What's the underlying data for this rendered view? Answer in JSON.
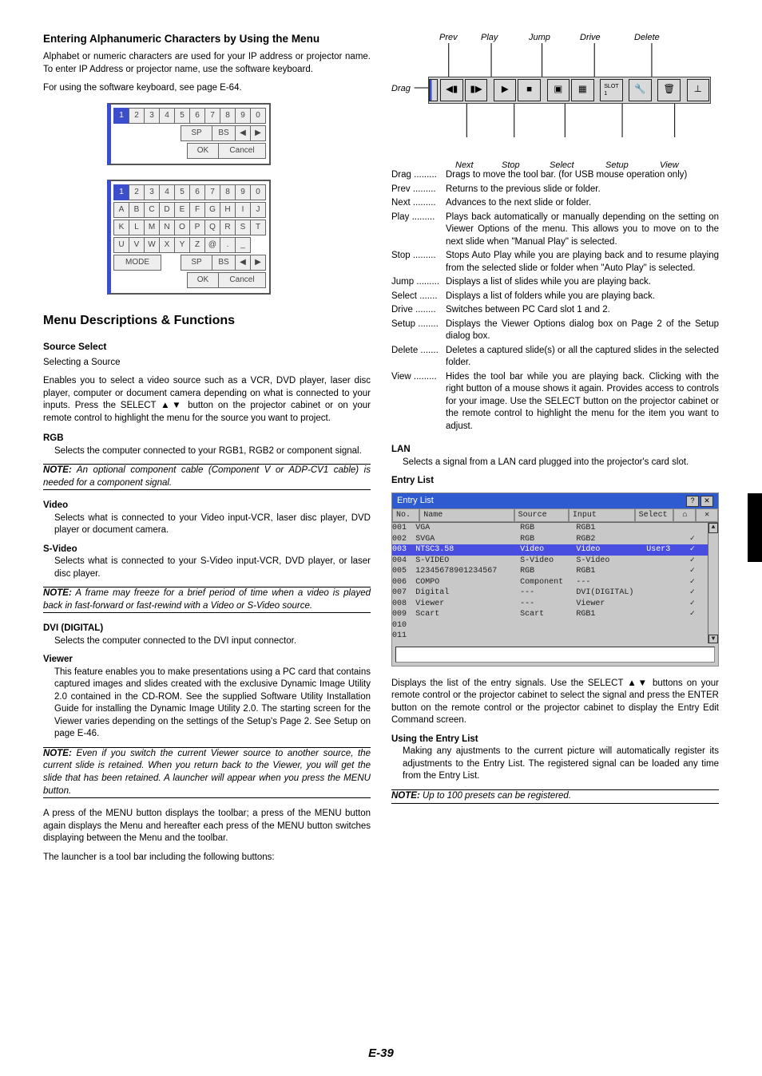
{
  "page_number": "E-39",
  "left": {
    "h_enter": "Entering Alphanumeric Characters by Using the Menu",
    "p_enter1": "Alphabet or numeric characters are used for your IP address or projector name. To enter IP Address or projector name, use the software keyboard.",
    "p_enter2": "For using the software keyboard, see page E-64.",
    "kb_digits": [
      "1",
      "2",
      "3",
      "4",
      "5",
      "6",
      "7",
      "8",
      "9",
      "0"
    ],
    "kb_sp": "SP",
    "kb_bs": "BS",
    "kb_ok": "OK",
    "kb_cancel": "Cancel",
    "kb_alpha": [
      [
        "A",
        "B",
        "C",
        "D",
        "E",
        "F",
        "G",
        "H",
        "I",
        "J"
      ],
      [
        "K",
        "L",
        "M",
        "N",
        "O",
        "P",
        "Q",
        "R",
        "S",
        "T"
      ],
      [
        "U",
        "V",
        "W",
        "X",
        "Y",
        "Z",
        "@",
        ".",
        "_"
      ]
    ],
    "kb_mode": "MODE",
    "h_menu": "Menu Descriptions & Functions",
    "h_source": "Source Select",
    "p_source1": "Selecting a Source",
    "p_source2": "Enables you to select a video source such as a VCR, DVD player, laser disc player, computer or document camera depending on what is connected to your inputs. Press the SELECT ▲▼ button on the projector cabinet or on your remote control to highlight the menu for the source you want to project.",
    "h_rgb": "RGB",
    "p_rgb": "Selects the computer connected to your RGB1, RGB2 or component signal.",
    "note_rgb": "An optional component cable (Component V or ADP-CV1 cable) is needed for a component signal.",
    "h_video": "Video",
    "p_video": "Selects what is connected to your Video input-VCR, laser disc player, DVD player or document camera.",
    "h_svideo": "S-Video",
    "p_svideo": "Selects what is connected to your S-Video input-VCR, DVD player, or laser disc player.",
    "note_svideo": "A frame may freeze for a brief period of time when a video is played back in fast-forward or fast-rewind with a Video or S-Video source.",
    "h_dvi": "DVI (DIGITAL)",
    "p_dvi": "Selects the computer connected to the DVI input connector.",
    "h_viewer": "Viewer",
    "p_viewer": "This feature enables you to make presentations using a PC card that contains captured images and slides created with the exclusive Dynamic Image Utility 2.0 contained in the CD-ROM. See the supplied Software Utility Installation Guide for installing the Dynamic Image Utility 2.0. The starting screen for the Viewer varies depending on the settings of the Setup's Page 2. See Setup on page E-46.",
    "note_viewer": "Even if you switch the current Viewer source to another source, the current slide is retained. When you return back to the Viewer, you will get the slide that has been retained. A launcher will appear when you press the MENU button.",
    "p_launcher": "A press of the MENU button displays the toolbar; a press of the MENU button again displays the Menu and hereafter each press of the MENU button switches displaying between the Menu and the toolbar.",
    "p_launcher2": "The launcher is a tool bar including the following buttons:"
  },
  "toolbar": {
    "labels_top": {
      "prev": "Prev",
      "play": "Play",
      "jump": "Jump",
      "drive": "Drive",
      "delete": "Delete"
    },
    "labels_bot": {
      "next": "Next",
      "stop": "Stop",
      "select": "Select",
      "setup": "Setup",
      "view": "View"
    },
    "drag": "Drag"
  },
  "defs": [
    {
      "t": "Drag",
      "d": "Drags to move the tool bar. (for USB mouse operation only)"
    },
    {
      "t": "Prev",
      "d": "Returns to the previous slide or folder."
    },
    {
      "t": "Next",
      "d": "Advances to the next slide or folder."
    },
    {
      "t": "Play",
      "d": "Plays back automatically or manually depending on the setting on Viewer Options of the menu. This allows you to move on to the next slide when \"Manual Play\" is selected."
    },
    {
      "t": "Stop",
      "d": "Stops Auto Play while you are playing back and to resume playing from the selected slide or folder when \"Auto Play\" is selected."
    },
    {
      "t": "Jump",
      "d": "Displays a list of slides while you are playing back."
    },
    {
      "t": "Select",
      "d": "Displays a list of folders while you are playing back."
    },
    {
      "t": "Drive",
      "d": "Switches between PC Card slot 1 and 2."
    },
    {
      "t": "Setup",
      "d": "Displays the Viewer Options dialog box on Page 2 of the Setup dialog box."
    },
    {
      "t": "Delete",
      "d": "Deletes a captured slide(s) or all the captured slides in the selected folder."
    },
    {
      "t": "View",
      "d": "Hides the tool bar while you are playing back. Clicking with the right button of a mouse shows it again. Provides access to controls for your image. Use the SELECT button on the projector cabinet or the remote control to highlight the menu for the item you want to adjust."
    }
  ],
  "right": {
    "h_lan": "LAN",
    "p_lan": "Selects a signal from a LAN card plugged into the projector's card slot.",
    "h_entry": "Entry List",
    "entry_title": "Entry List",
    "hdr": {
      "no": "No.",
      "name": "Name",
      "src": "Source",
      "in": "Input",
      "sel": "Select",
      "house": "⌂",
      "x": "✕"
    },
    "rows": [
      {
        "no": "001",
        "name": "VGA",
        "src": "RGB",
        "in": "RGB1",
        "sel": "",
        "ck": ""
      },
      {
        "no": "002",
        "name": "SVGA",
        "src": "RGB",
        "in": "RGB2",
        "sel": "",
        "ck": "✓"
      },
      {
        "no": "003",
        "name": "NTSC3.58",
        "src": "Video",
        "in": "Video",
        "sel": "User3",
        "ck": "✓",
        "hi": true
      },
      {
        "no": "004",
        "name": "S-VIDEO",
        "src": "S-Video",
        "in": "S-Video",
        "sel": "",
        "ck": "✓"
      },
      {
        "no": "005",
        "name": "12345678901234567",
        "src": "RGB",
        "in": "RGB1",
        "sel": "",
        "ck": "✓"
      },
      {
        "no": "006",
        "name": "COMPO",
        "src": "Component",
        "in": "---",
        "sel": "",
        "ck": "✓"
      },
      {
        "no": "007",
        "name": "Digital",
        "src": "---",
        "in": "DVI(DIGITAL)",
        "sel": "",
        "ck": "✓"
      },
      {
        "no": "008",
        "name": "Viewer",
        "src": "---",
        "in": "Viewer",
        "sel": "",
        "ck": "✓"
      },
      {
        "no": "009",
        "name": "Scart",
        "src": "Scart",
        "in": "RGB1",
        "sel": "",
        "ck": "✓"
      },
      {
        "no": "010",
        "name": "",
        "src": "",
        "in": "",
        "sel": "",
        "ck": ""
      },
      {
        "no": "011",
        "name": "",
        "src": "",
        "in": "",
        "sel": "",
        "ck": ""
      }
    ],
    "p_entry1": "Displays the list of the entry signals. Use the SELECT ▲▼ buttons on your remote control or the projector cabinet to select the signal and press the ENTER button on the remote control or the projector cabinet to display the Entry Edit Command screen.",
    "h_using": "Using the Entry List",
    "p_using": "Making any ajustments to the current picture will automatically register its adjustments to the Entry List. The registered signal can be loaded any time from the Entry List.",
    "note_entry": "Up to 100 presets can be registered.",
    "note_label": "NOTE:"
  },
  "note_label": "NOTE:"
}
